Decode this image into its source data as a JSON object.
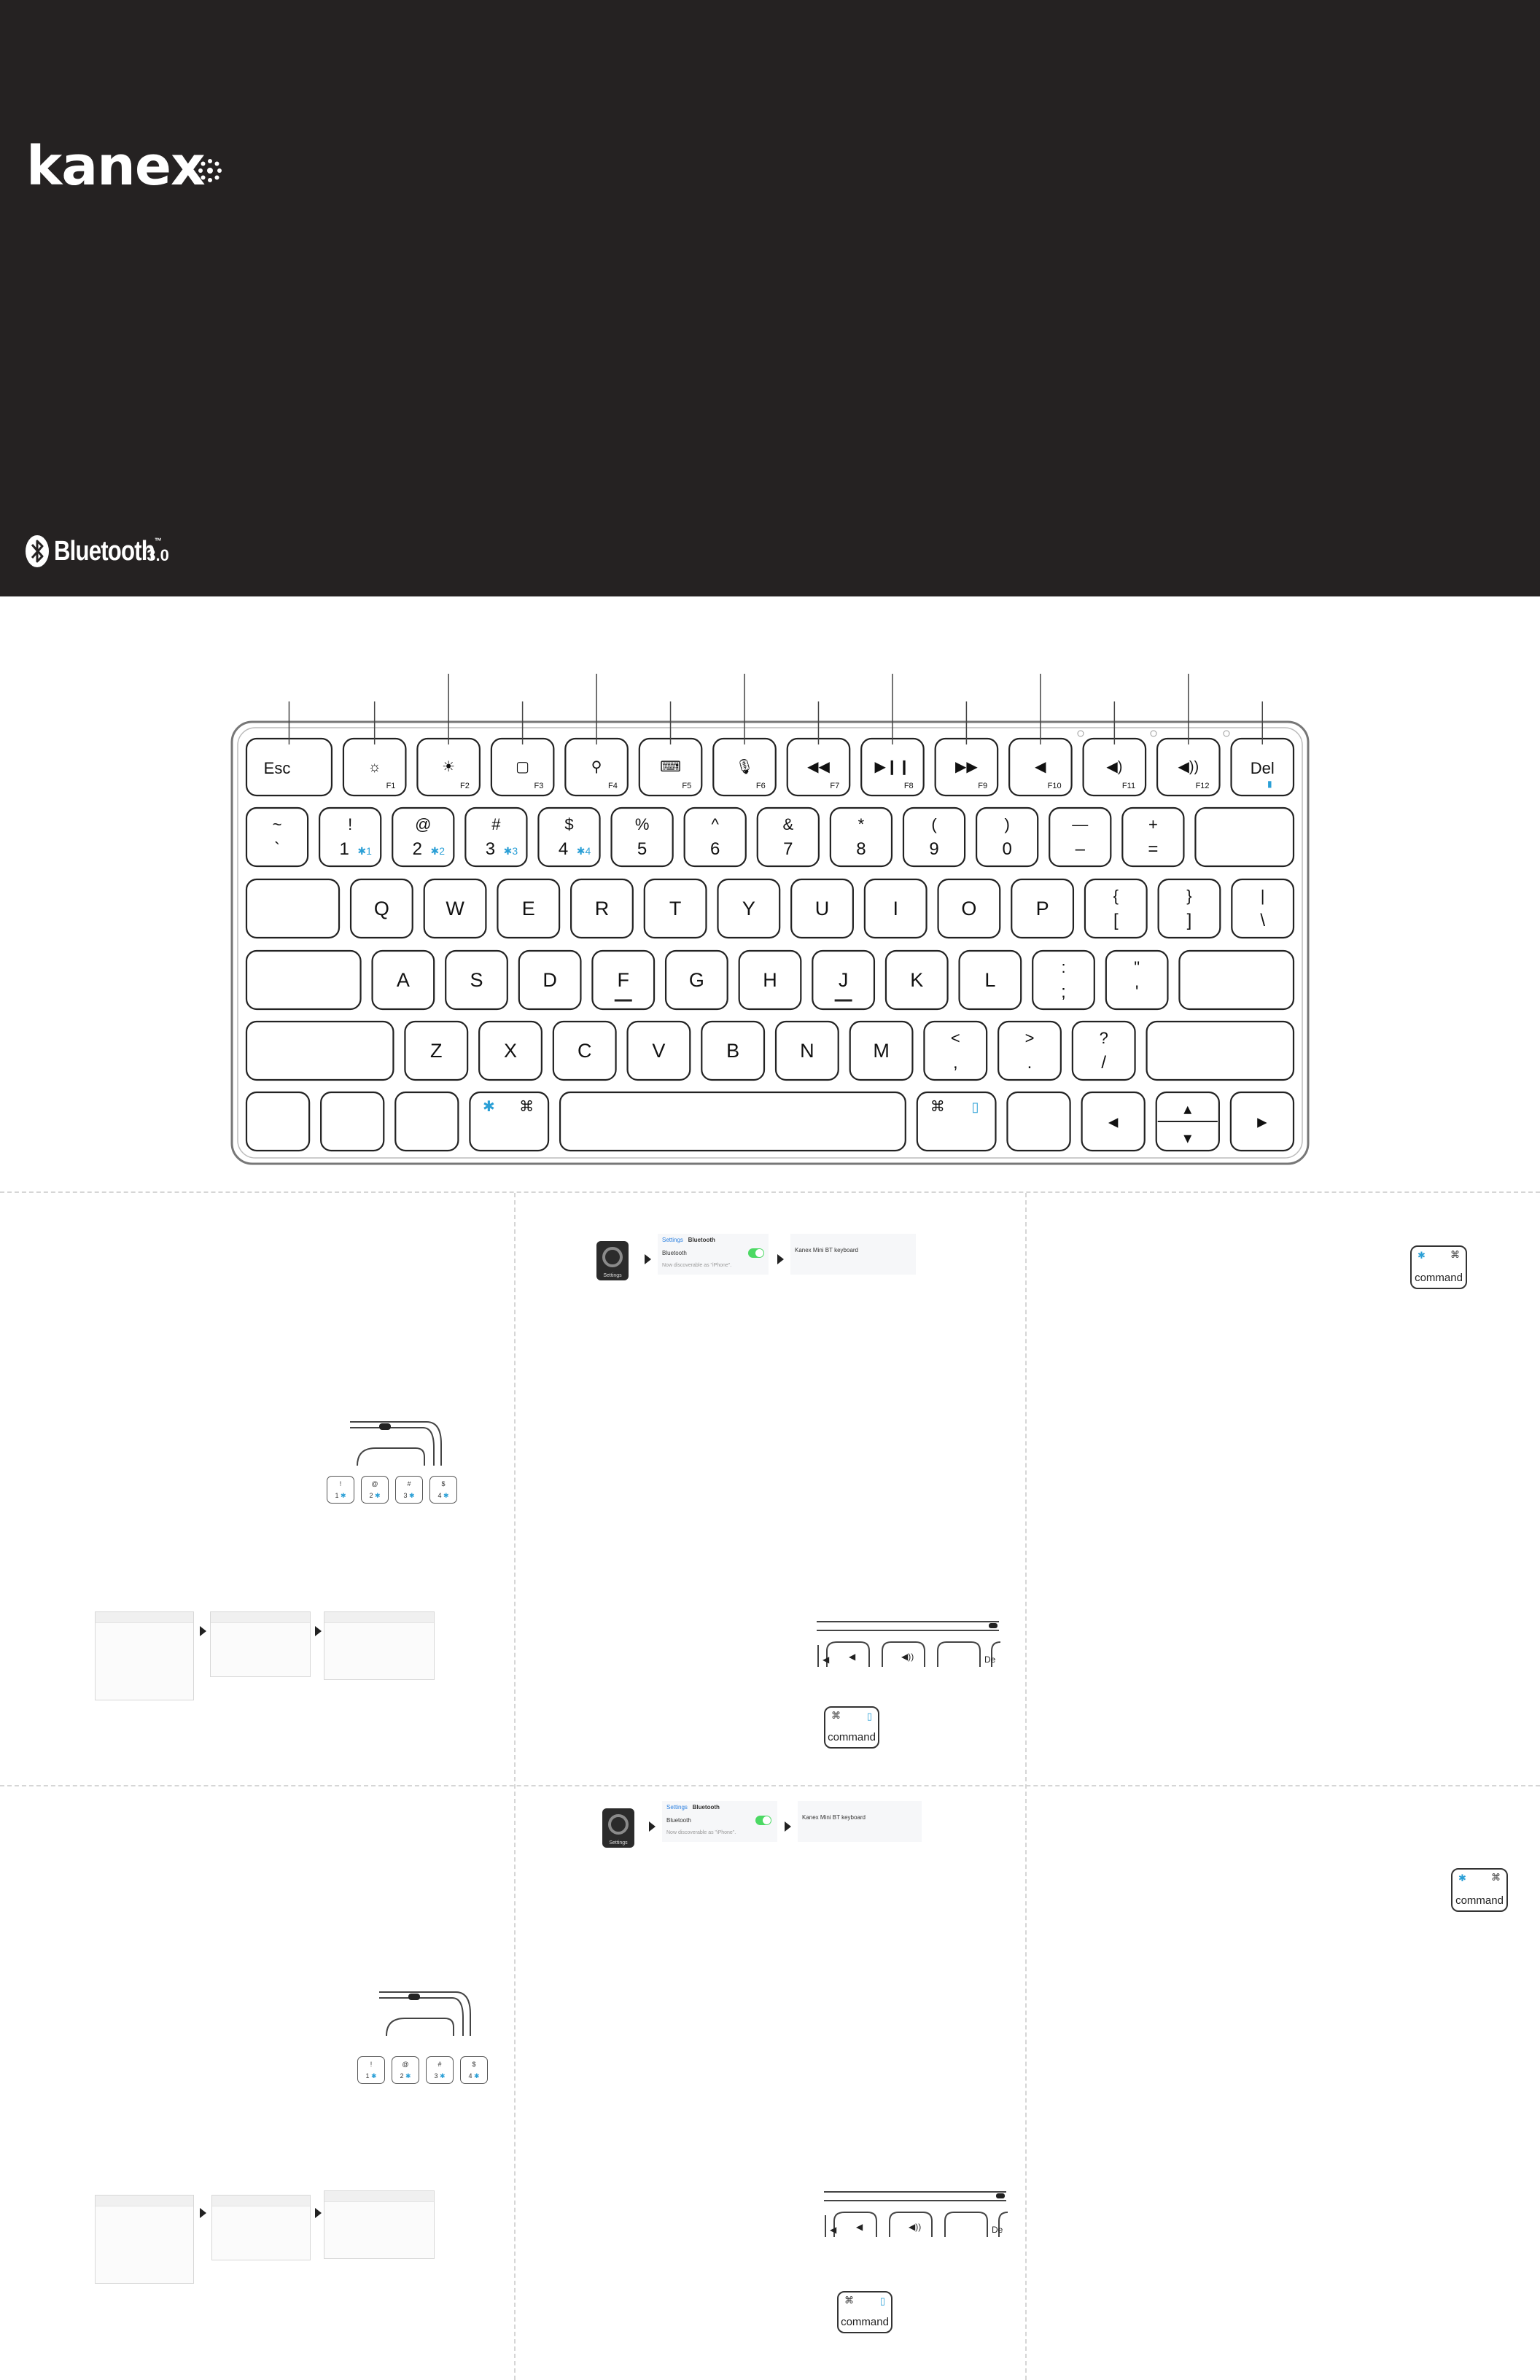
{
  "brand": {
    "name": "kanex"
  },
  "badge": {
    "name": "Bluetooth",
    "tm": "™",
    "version": "3.0"
  },
  "keyboard": {
    "rows": [
      [
        {
          "id": "esc",
          "w": 1.3,
          "bottom": "Esc"
        },
        {
          "id": "f1",
          "w": 0.95,
          "icon": "brightness-down",
          "fn": "F1"
        },
        {
          "id": "f2",
          "w": 0.95,
          "icon": "brightness-up",
          "fn": "F2"
        },
        {
          "id": "f3",
          "w": 0.95,
          "icon": "home",
          "fn": "F3"
        },
        {
          "id": "f4",
          "w": 0.95,
          "icon": "search",
          "fn": "F4"
        },
        {
          "id": "f5",
          "w": 0.95,
          "icon": "keyboard",
          "fn": "F5"
        },
        {
          "id": "f6",
          "w": 0.95,
          "icon": "mic",
          "fn": "F6"
        },
        {
          "id": "f7",
          "w": 0.95,
          "icon": "rewind",
          "fn": "F7"
        },
        {
          "id": "f8",
          "w": 0.95,
          "icon": "play-pause",
          "fn": "F8"
        },
        {
          "id": "f9",
          "w": 0.95,
          "icon": "fast-forward",
          "fn": "F9"
        },
        {
          "id": "f10",
          "w": 0.95,
          "icon": "mute",
          "fn": "F10"
        },
        {
          "id": "f11",
          "w": 0.95,
          "icon": "volume-down",
          "fn": "F11"
        },
        {
          "id": "f12",
          "w": 0.95,
          "icon": "volume-up",
          "fn": "F12"
        },
        {
          "id": "del",
          "w": 0.95,
          "bottom": "Del",
          "icon": "lock-small"
        }
      ],
      [
        {
          "id": "tilde",
          "w": 1,
          "top": "~",
          "bottom": "`"
        },
        {
          "id": "1",
          "w": 1,
          "top": "!",
          "bottom": "1",
          "bt": "1"
        },
        {
          "id": "2",
          "w": 1,
          "top": "@",
          "bottom": "2",
          "bt": "2"
        },
        {
          "id": "3",
          "w": 1,
          "top": "#",
          "bottom": "3",
          "bt": "3"
        },
        {
          "id": "4",
          "w": 1,
          "top": "$",
          "bottom": "4",
          "bt": "4"
        },
        {
          "id": "5",
          "w": 1,
          "top": "%",
          "bottom": "5"
        },
        {
          "id": "6",
          "w": 1,
          "top": "^",
          "bottom": "6"
        },
        {
          "id": "7",
          "w": 1,
          "top": "&",
          "bottom": "7"
        },
        {
          "id": "8",
          "w": 1,
          "top": "*",
          "bottom": "8"
        },
        {
          "id": "9",
          "w": 1,
          "top": "(",
          "bottom": "9"
        },
        {
          "id": "0",
          "w": 1,
          "top": ")",
          "bottom": "0"
        },
        {
          "id": "minus",
          "w": 1,
          "top": "—",
          "bottom": "–"
        },
        {
          "id": "equal",
          "w": 1,
          "top": "+",
          "bottom": "="
        },
        {
          "id": "backspace",
          "w": 1.6
        }
      ],
      [
        {
          "id": "tab",
          "w": 1.5
        },
        {
          "id": "q",
          "w": 1,
          "center": "Q"
        },
        {
          "id": "w",
          "w": 1,
          "center": "W"
        },
        {
          "id": "e",
          "w": 1,
          "center": "E"
        },
        {
          "id": "r",
          "w": 1,
          "center": "R"
        },
        {
          "id": "t",
          "w": 1,
          "center": "T"
        },
        {
          "id": "y",
          "w": 1,
          "center": "Y"
        },
        {
          "id": "u",
          "w": 1,
          "center": "U"
        },
        {
          "id": "i",
          "w": 1,
          "center": "I"
        },
        {
          "id": "o",
          "w": 1,
          "center": "O"
        },
        {
          "id": "p",
          "w": 1,
          "center": "P"
        },
        {
          "id": "lbrace",
          "w": 1,
          "top": "{",
          "bottom": "["
        },
        {
          "id": "rbrace",
          "w": 1,
          "top": "}",
          "bottom": "]"
        },
        {
          "id": "pipe",
          "w": 1,
          "top": "|",
          "bottom": "\\"
        }
      ],
      [
        {
          "id": "caps",
          "w": 1.85
        },
        {
          "id": "a",
          "w": 1,
          "center": "A"
        },
        {
          "id": "s",
          "w": 1,
          "center": "S"
        },
        {
          "id": "d",
          "w": 1,
          "center": "D"
        },
        {
          "id": "f",
          "w": 1,
          "center": "F",
          "bump": true
        },
        {
          "id": "g",
          "w": 1,
          "center": "G"
        },
        {
          "id": "h",
          "w": 1,
          "center": "H"
        },
        {
          "id": "j",
          "w": 1,
          "center": "J",
          "bump": true
        },
        {
          "id": "k",
          "w": 1,
          "center": "K"
        },
        {
          "id": "l",
          "w": 1,
          "center": "L"
        },
        {
          "id": "semicolon",
          "w": 1,
          "top": ":",
          "bottom": ";"
        },
        {
          "id": "quote",
          "w": 1,
          "top": "\"",
          "bottom": "'"
        },
        {
          "id": "enter",
          "w": 1.85
        }
      ],
      [
        {
          "id": "lshift",
          "w": 2.35
        },
        {
          "id": "z",
          "w": 1,
          "center": "Z"
        },
        {
          "id": "x",
          "w": 1,
          "center": "X"
        },
        {
          "id": "c",
          "w": 1,
          "center": "C"
        },
        {
          "id": "v",
          "w": 1,
          "center": "V"
        },
        {
          "id": "b",
          "w": 1,
          "center": "B"
        },
        {
          "id": "n",
          "w": 1,
          "center": "N"
        },
        {
          "id": "m",
          "w": 1,
          "center": "M"
        },
        {
          "id": "comma",
          "w": 1,
          "top": "<",
          "bottom": ","
        },
        {
          "id": "period",
          "w": 1,
          "top": ">",
          "bottom": "."
        },
        {
          "id": "slash",
          "w": 1,
          "top": "?",
          "bottom": "/"
        },
        {
          "id": "rshift",
          "w": 2.35
        }
      ],
      [
        {
          "id": "fn",
          "w": 1
        },
        {
          "id": "ctrl",
          "w": 1
        },
        {
          "id": "alt",
          "w": 1
        },
        {
          "id": "lcmd",
          "w": 1.25,
          "icon": "bt-cmd-left"
        },
        {
          "id": "space",
          "w": 5.5
        },
        {
          "id": "rcmd",
          "w": 1.25,
          "icon": "cmd-right"
        },
        {
          "id": "ralt",
          "w": 1
        },
        {
          "id": "left",
          "w": 1,
          "center": "◂"
        },
        {
          "id": "updown",
          "w": 1,
          "split": [
            "▴",
            "▾"
          ]
        },
        {
          "id": "right",
          "w": 1,
          "center": "▸"
        }
      ]
    ]
  },
  "thumbnails": {
    "settings_label": "Settings",
    "ios_back": "Settings",
    "ios_title": "Bluetooth",
    "ios_bt_row": "Bluetooth",
    "ios_discoverable": "Now discoverable as \"iPhone\".",
    "ios_devices": "Kanex Mini BT keyboard",
    "cmd_label": "command",
    "cmd_glyph": "⌘",
    "key_num": [
      "1",
      "2",
      "3",
      "4"
    ],
    "key_sym": [
      "!",
      "@",
      "#",
      "$"
    ]
  }
}
